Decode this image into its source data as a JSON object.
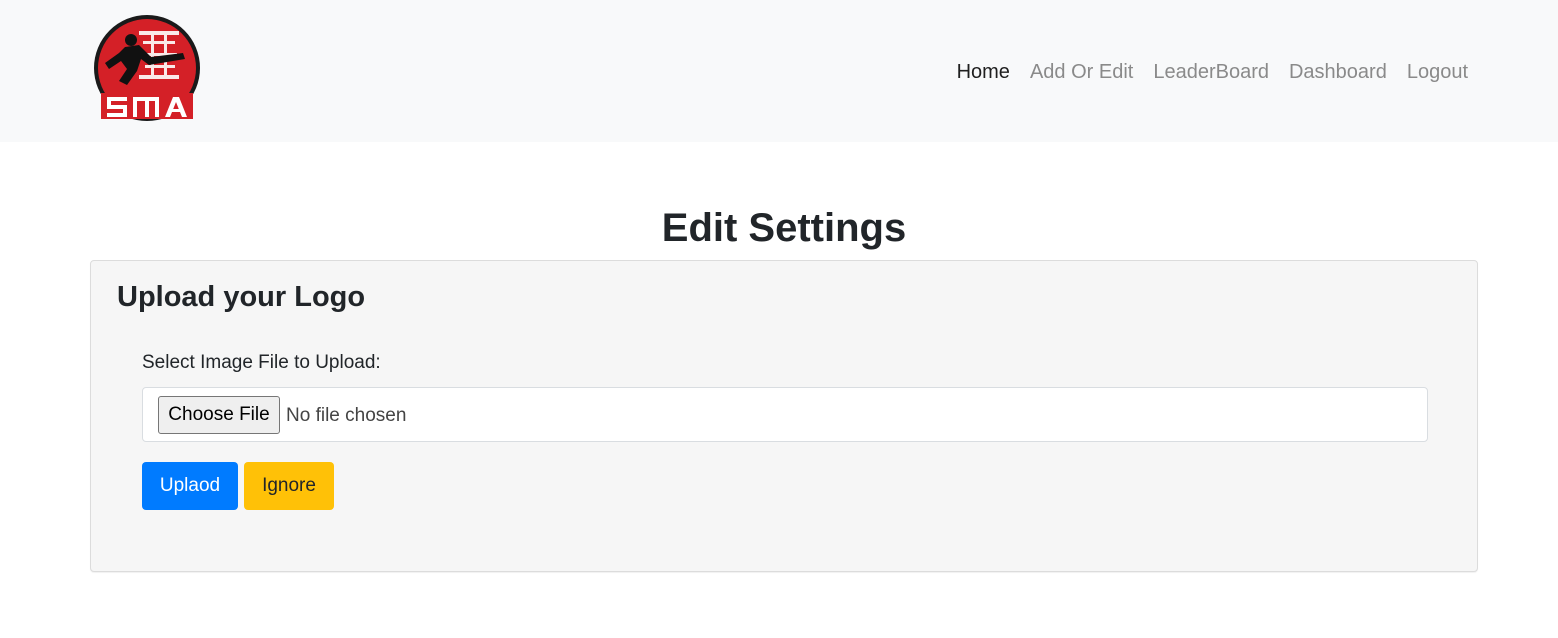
{
  "brand": {
    "logo_text": "SMA",
    "colors": {
      "red": "#d42027",
      "black": "#1a1a1a"
    }
  },
  "nav": {
    "items": [
      {
        "label": "Home",
        "active": true
      },
      {
        "label": "Add Or Edit",
        "active": false
      },
      {
        "label": "LeaderBoard",
        "active": false
      },
      {
        "label": "Dashboard",
        "active": false
      },
      {
        "label": "Logout",
        "active": false
      }
    ]
  },
  "page": {
    "title": "Edit Settings"
  },
  "upload_card": {
    "title": "Upload your Logo",
    "field_label": "Select Image File to Upload:",
    "choose_file_label": "Choose File",
    "file_status": "No file chosen",
    "upload_button": "Uplaod",
    "ignore_button": "Ignore"
  },
  "colors": {
    "navbar_bg": "#f8f9fa",
    "primary": "#007bff",
    "warning": "#ffc107",
    "card_bg": "#f6f6f6"
  }
}
